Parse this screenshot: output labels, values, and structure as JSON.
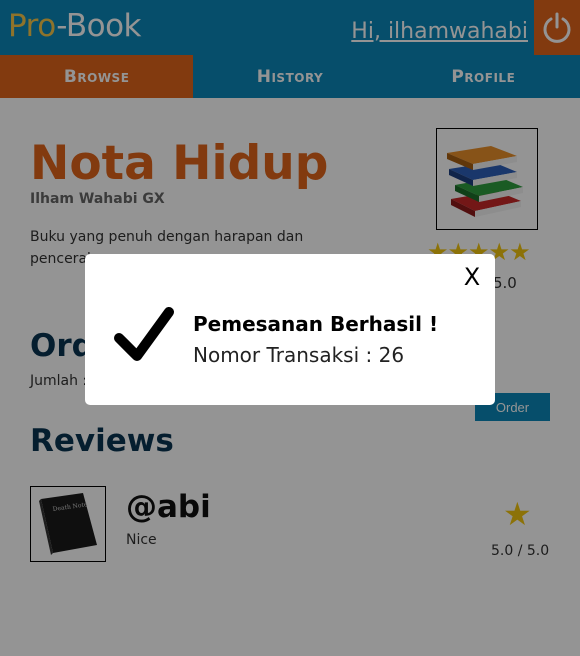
{
  "header": {
    "logo_part1": "Pro",
    "logo_part2": "-Book",
    "greeting": "Hi, ilhamwahabi",
    "power_icon": "power-icon"
  },
  "nav": {
    "tabs": [
      {
        "label": "Browse",
        "active": true
      },
      {
        "label": "History",
        "active": false
      },
      {
        "label": "Profile",
        "active": false
      }
    ]
  },
  "book": {
    "title": "Nota Hidup",
    "author": "Ilham Wahabi GX",
    "description": "Buku yang penuh dengan harapan dan pencerahan",
    "stars": "★★★★★",
    "rating": "5.0"
  },
  "order": {
    "title": "Order",
    "quantity_label": "Jumlah :",
    "button_label": "Order"
  },
  "reviews": {
    "title": "Reviews",
    "items": [
      {
        "user": "@abi",
        "text": "Nice",
        "star": "★",
        "score": "5.0 / 5.0"
      }
    ]
  },
  "modal": {
    "close_label": "X",
    "title": "Pemesanan Berhasil !",
    "transaction_text": "Nomor Transaksi : 26"
  },
  "colors": {
    "primary": "#0b87b8",
    "accent": "#e0651a",
    "star": "#f2c40f",
    "dark_heading": "#0a3552"
  }
}
